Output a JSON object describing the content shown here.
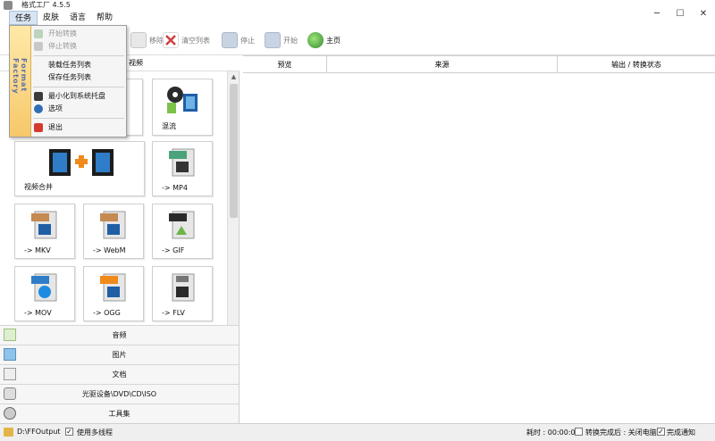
{
  "window": {
    "title": "格式工厂 4.5.5",
    "minimize": "─",
    "maximize": "☐",
    "close": "✕"
  },
  "menubar": {
    "items": [
      "任务",
      "皮肤",
      "语言",
      "帮助"
    ]
  },
  "toolbar": {
    "remove": "移除",
    "clear": "清空列表",
    "stop": "停止",
    "start": "开始",
    "home": "主页"
  },
  "dropdown": {
    "brand": "Format Factory",
    "items": [
      {
        "label": "开始转换",
        "enabled": false
      },
      {
        "label": "停止转换",
        "enabled": false
      },
      {
        "label": "装载任务列表",
        "enabled": true
      },
      {
        "label": "保存任务列表",
        "enabled": true
      },
      {
        "label": "最小化到系统托盘",
        "enabled": true
      },
      {
        "label": "选项",
        "enabled": true
      },
      {
        "label": "退出",
        "enabled": true
      }
    ]
  },
  "left": {
    "header": "视频",
    "tiles": [
      {
        "label": "混流",
        "icon": "film-music-icon"
      },
      {
        "label": "视频合并",
        "icon": "film-merge-icon"
      },
      {
        "label": "-> MP4",
        "icon": "mp4-file-icon"
      },
      {
        "label": "-> MKV",
        "icon": "mkv-file-icon"
      },
      {
        "label": "-> WebM",
        "icon": "webm-file-icon"
      },
      {
        "label": "-> GIF",
        "icon": "gif-file-icon"
      },
      {
        "label": "-> MOV",
        "icon": "mov-file-icon"
      },
      {
        "label": "-> OGG",
        "icon": "ogg-file-icon"
      },
      {
        "label": "-> FLV",
        "icon": "flv-file-icon"
      }
    ],
    "categories": [
      {
        "label": "音频",
        "icon": "music-note-icon"
      },
      {
        "label": "图片",
        "icon": "picture-icon"
      },
      {
        "label": "文档",
        "icon": "document-icon"
      },
      {
        "label": "光驱设备\\DVD\\CD\\ISO",
        "icon": "disc-drive-icon"
      },
      {
        "label": "工具集",
        "icon": "tools-icon"
      }
    ]
  },
  "list": {
    "columns": [
      "预览",
      "来源",
      "输出 / 转换状态"
    ]
  },
  "status": {
    "output_path": "D:\\FFOutput",
    "multithread": "使用多线程",
    "elapsed": "耗时 : 00:00:00",
    "after_convert": "转换完成后 : 关闭电脑",
    "notify": "完成通知"
  },
  "colors": {
    "accent": "#2f6db5",
    "menu_strip": "#f6c86a",
    "film": "#1e5fa6"
  }
}
